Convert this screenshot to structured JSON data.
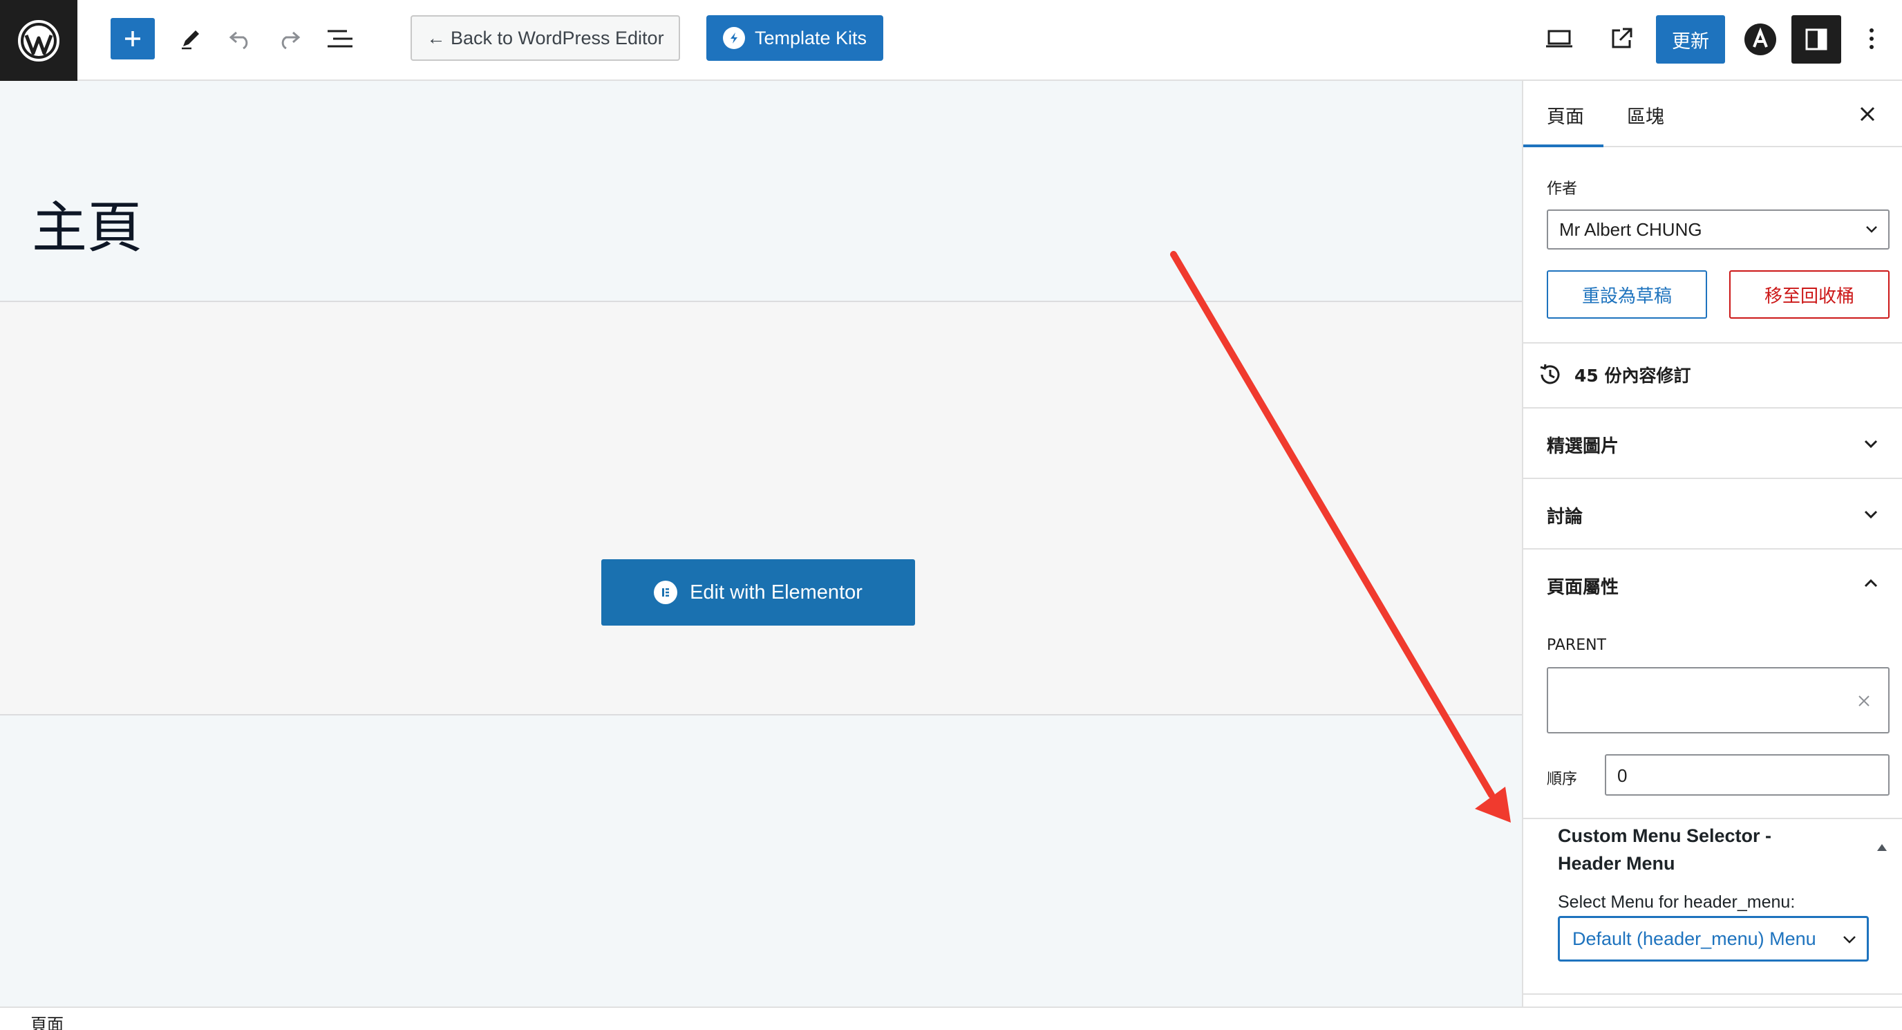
{
  "toolbar": {
    "back_label": "← Back to WordPress Editor",
    "kits_label": "Template Kits",
    "update_label": "更新",
    "icons": [
      "wordpress-logo-icon",
      "plus-icon",
      "pencil-icon",
      "undo-icon",
      "redo-icon",
      "list-view-icon",
      "desktop-preview-icon",
      "external-link-icon",
      "astra-icon",
      "sidebar-toggle-icon",
      "more-vertical-icon"
    ]
  },
  "canvas": {
    "page_title": "主頁",
    "edit_button_label": "Edit with Elementor"
  },
  "footer": {
    "breadcrumb": "頁面"
  },
  "sidebar": {
    "tabs": [
      {
        "label": "頁面"
      },
      {
        "label": "區塊"
      }
    ],
    "author_label": "作者",
    "author_value": "Mr Albert CHUNG",
    "draft_button": "重設為草稿",
    "trash_button": "移至回收桶",
    "revisions": "45 份內容修訂",
    "panels": {
      "featured_image": "精選圖片",
      "discussion": "討論",
      "page_attributes": "頁面屬性"
    },
    "parent_label": "PARENT",
    "parent_value": "",
    "order_label": "順序",
    "order_value": "0",
    "custom_menu": {
      "title": "Custom Menu Selector - Header Menu",
      "select_label": "Select Menu for header_menu:",
      "selected": "Default (header_menu) Menu"
    }
  },
  "colors": {
    "accent": "#1e73be",
    "danger": "#cc1818",
    "arrow": "#f03a2e"
  }
}
